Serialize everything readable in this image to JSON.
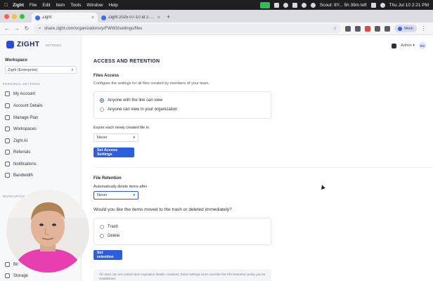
{
  "menubar": {
    "app": "Zight",
    "items": [
      "File",
      "Edit",
      "Item",
      "Tools",
      "Window",
      "Help"
    ],
    "status": "Scout: 8Y... 5h 39m left",
    "clock": "Thu Jul 10  2:21 PM"
  },
  "tabs": [
    {
      "label": "Zight",
      "active": true
    },
    {
      "label": "Zight 2025-07-10 at 2.16.01",
      "active": false
    }
  ],
  "toolbar": {
    "url": "share.zight.com/organizations/yrFWW3/settings/files",
    "profile": "Work"
  },
  "sidebar": {
    "logo": "ZIGHT",
    "logo_sub": "SETTINGS",
    "workspace_label": "Workspace",
    "workspace_value": "Zight (Enterprise)",
    "personal_header": "PERSONAL SETTINGS",
    "personal_items": [
      "My Account",
      "Account Details",
      "Manage Plan",
      "Workspaces",
      "Zight AI",
      "Referrals",
      "Notifications",
      "Bandwidth"
    ],
    "workspace_header": "WORKSPACE S",
    "workspace_items": [
      "Bil",
      "Storage"
    ]
  },
  "header": {
    "role": "Admin",
    "avatar": "RG"
  },
  "access": {
    "title": "ACCESS AND RETENTION",
    "files_heading": "Files Access",
    "files_desc": "Configure the settings for all files created by members of your team.",
    "option_link": "Anyone with the link can view",
    "option_org": "Anyone can view in your organization",
    "selected": "Anyone with the link can view",
    "expire_label": "Expire each newly created file in",
    "expire_value": "Never",
    "set_button": "Set Access Settings"
  },
  "retention": {
    "heading": "File Retention",
    "auto_label": "Automatically delete items after",
    "auto_value": "Never",
    "question": "Would you like the items moved to the trash or deleted immediately?",
    "option_trash": "Trash",
    "option_delete": "Delete",
    "set_button": "Set retention",
    "note": "All users can set custom item expiration details. However, these settings won't override the File Retention policy you've established."
  },
  "colors": {
    "accent": "#2c5ee0",
    "sidebar_bg": "#f7f8fa"
  }
}
